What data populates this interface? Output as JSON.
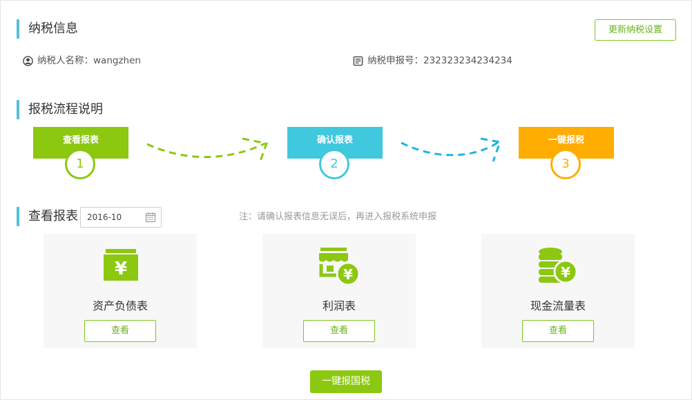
{
  "tax_info": {
    "title": "纳税信息",
    "update_button": "更新纳税设置",
    "taxpayer_name": "纳税人名称：wangzhen",
    "tax_number": "纳税申报号：232323234234234"
  },
  "process": {
    "title": "报税流程说明",
    "steps": [
      {
        "label": "查看报表",
        "number": "1",
        "color": "#8cc810"
      },
      {
        "label": "确认报表",
        "number": "2",
        "color": "#3fc8de"
      },
      {
        "label": "一键报税",
        "number": "3",
        "color": "#ffad00"
      }
    ]
  },
  "reports": {
    "title": "查看报表",
    "date_value": "2016-10",
    "note": "注：请确认报表信息无误后，再进入报税系统申报",
    "cards": [
      {
        "label": "资产负债表",
        "button": "查看",
        "icon": "balance-sheet-icon"
      },
      {
        "label": "利润表",
        "button": "查看",
        "icon": "profit-store-icon"
      },
      {
        "label": "现金流量表",
        "button": "查看",
        "icon": "cash-flow-coins-icon"
      }
    ],
    "submit_button": "一键报国税"
  },
  "colors": {
    "accent_green": "#8cc810",
    "accent_cyan": "#3fc8de",
    "accent_orange": "#ffad00",
    "section_bar": "#55c1d9"
  }
}
